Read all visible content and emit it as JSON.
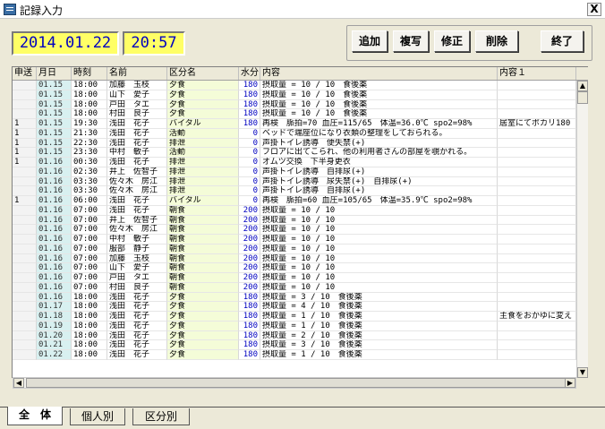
{
  "window": {
    "title": "記録入力",
    "close_label": "X"
  },
  "header": {
    "date": "2014.01.22",
    "time": "20:57"
  },
  "toolbar": {
    "add": "追加",
    "copy": "複写",
    "edit": "修正",
    "delete": "削除",
    "exit": "終了"
  },
  "grid": {
    "columns": [
      "申送",
      "月日",
      "時刻",
      "名前",
      "区分名",
      "水分",
      "内容",
      "内容１"
    ],
    "rows": [
      [
        "",
        "01.15",
        "18:00",
        "加藤　玉枝",
        "夕食",
        "180",
        "摂取量 = 10 / 10　食後薬",
        ""
      ],
      [
        "",
        "01.15",
        "18:00",
        "山下　愛子",
        "夕食",
        "180",
        "摂取量 = 10 / 10　食後薬",
        ""
      ],
      [
        "",
        "01.15",
        "18:00",
        "戸田　タエ",
        "夕食",
        "180",
        "摂取量 = 10 / 10　食後薬",
        ""
      ],
      [
        "",
        "01.15",
        "18:00",
        "村田　良子",
        "夕食",
        "180",
        "摂取量 = 10 / 10　食後薬",
        ""
      ],
      [
        "1",
        "01.15",
        "19:30",
        "浅田　花子",
        "バイタル",
        "180",
        "再検　脈拍=70 血圧=115/65　体温=36.0℃ spo2=98%",
        "居室にてポカリ180"
      ],
      [
        "1",
        "01.15",
        "21:30",
        "浅田　花子",
        "活動",
        "0",
        "ベッドで端座位になり衣類の整理をしておられる。",
        ""
      ],
      [
        "1",
        "01.15",
        "22:30",
        "浅田　花子",
        "排泄",
        "0",
        "声掛トイレ誘導　便失禁(+)",
        ""
      ],
      [
        "1",
        "01.15",
        "23:30",
        "中村　敏子",
        "活動",
        "0",
        "フロアに出てこられ、他の利用者さんの部屋を覗かれる。",
        ""
      ],
      [
        "1",
        "01.16",
        "00:30",
        "浅田　花子",
        "排泄",
        "0",
        "オムツ交換　下半身更衣",
        ""
      ],
      [
        "",
        "01.16",
        "02:30",
        "井上　佐智子",
        "排泄",
        "0",
        "声掛トイレ誘導　自排尿(+)",
        ""
      ],
      [
        "",
        "01.16",
        "03:30",
        "佐々木　房江",
        "排泄",
        "0",
        "声掛トイレ誘導　尿失禁(+)　自排尿(+)",
        ""
      ],
      [
        "",
        "01.16",
        "03:30",
        "佐々木　房江",
        "排泄",
        "0",
        "声掛トイレ誘導　自排尿(+)",
        ""
      ],
      [
        "1",
        "01.16",
        "06:00",
        "浅田　花子",
        "バイタル",
        "0",
        "再検　脈拍=60 血圧=105/65　体温=35.9℃ spo2=98%",
        ""
      ],
      [
        "",
        "01.16",
        "07:00",
        "浅田　花子",
        "朝食",
        "200",
        "摂取量 = 10 / 10",
        ""
      ],
      [
        "",
        "01.16",
        "07:00",
        "井上　佐智子",
        "朝食",
        "200",
        "摂取量 = 10 / 10",
        ""
      ],
      [
        "",
        "01.16",
        "07:00",
        "佐々木　房江",
        "朝食",
        "200",
        "摂取量 = 10 / 10",
        ""
      ],
      [
        "",
        "01.16",
        "07:00",
        "中村　敏子",
        "朝食",
        "200",
        "摂取量 = 10 / 10",
        ""
      ],
      [
        "",
        "01.16",
        "07:00",
        "服部　静子",
        "朝食",
        "200",
        "摂取量 = 10 / 10",
        ""
      ],
      [
        "",
        "01.16",
        "07:00",
        "加藤　玉枝",
        "朝食",
        "200",
        "摂取量 = 10 / 10",
        ""
      ],
      [
        "",
        "01.16",
        "07:00",
        "山下　愛子",
        "朝食",
        "200",
        "摂取量 = 10 / 10",
        ""
      ],
      [
        "",
        "01.16",
        "07:00",
        "戸田　タエ",
        "朝食",
        "200",
        "摂取量 = 10 / 10",
        ""
      ],
      [
        "",
        "01.16",
        "07:00",
        "村田　良子",
        "朝食",
        "200",
        "摂取量 = 10 / 10",
        ""
      ],
      [
        "",
        "01.16",
        "18:00",
        "浅田　花子",
        "夕食",
        "180",
        "摂取量 = 3 / 10　食後薬",
        ""
      ],
      [
        "",
        "01.17",
        "18:00",
        "浅田　花子",
        "夕食",
        "180",
        "摂取量 = 4 / 10　食後薬",
        ""
      ],
      [
        "",
        "01.18",
        "18:00",
        "浅田　花子",
        "夕食",
        "180",
        "摂取量 = 1 / 10　食後薬",
        "主食をおかゆに変え"
      ],
      [
        "",
        "01.19",
        "18:00",
        "浅田　花子",
        "夕食",
        "180",
        "摂取量 = 1 / 10　食後薬",
        ""
      ],
      [
        "",
        "01.20",
        "18:00",
        "浅田　花子",
        "夕食",
        "180",
        "摂取量 = 2 / 10　食後薬",
        ""
      ],
      [
        "",
        "01.21",
        "18:00",
        "浅田　花子",
        "夕食",
        "180",
        "摂取量 = 3 / 10　食後薬",
        ""
      ],
      [
        "",
        "01.22",
        "18:00",
        "浅田　花子",
        "夕食",
        "180",
        "摂取量 = 1 / 10　食後薬",
        ""
      ]
    ]
  },
  "tabs": [
    "全　体",
    "個人別",
    "区分別"
  ],
  "active_tab": 0
}
